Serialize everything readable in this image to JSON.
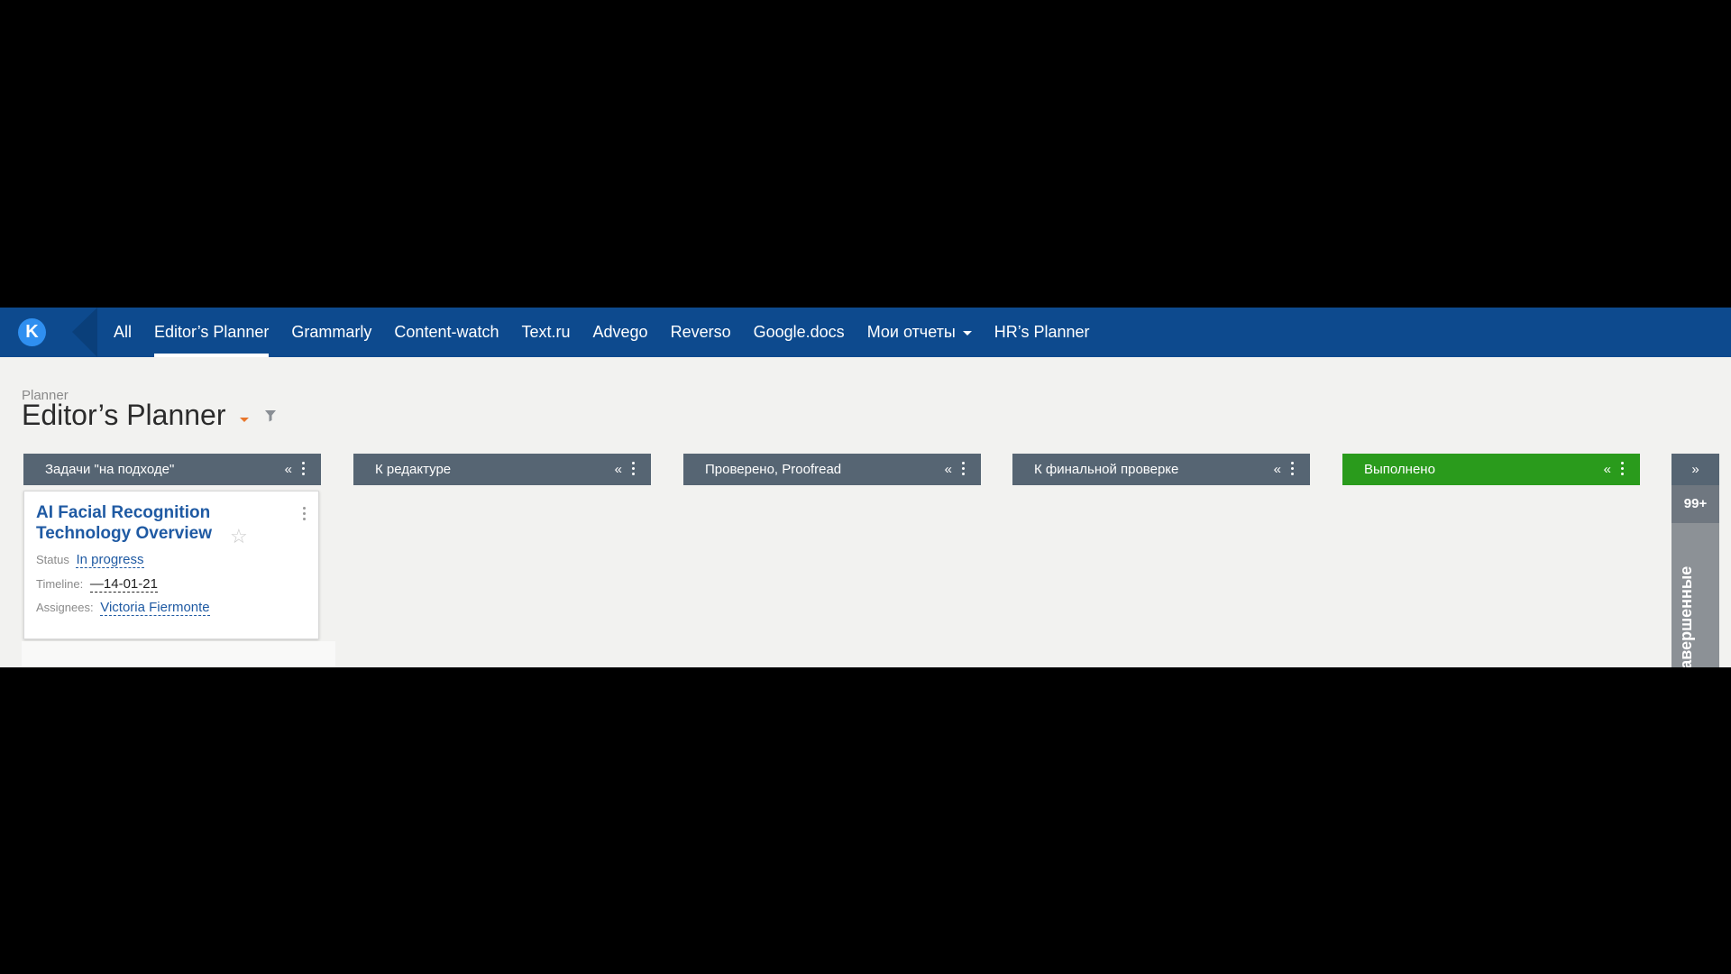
{
  "app": {
    "logo_letter": "K",
    "nav": [
      {
        "label": "All"
      },
      {
        "label": "Editor’s Planner",
        "active": true
      },
      {
        "label": "Grammarly"
      },
      {
        "label": "Content-watch"
      },
      {
        "label": "Text.ru"
      },
      {
        "label": "Advego"
      },
      {
        "label": "Reverso"
      },
      {
        "label": "Google.docs"
      },
      {
        "label": "Мои отчеты",
        "dropdown": true
      },
      {
        "label": "HR’s Planner"
      }
    ],
    "colors": {
      "nav_bg": "#0d4a8e",
      "column_header": "#566573",
      "done_header": "#2a9b1c",
      "link": "#1f5aa3",
      "accent": "#e8762b"
    }
  },
  "page": {
    "breadcrumb": "Planner",
    "title": "Editor’s Planner"
  },
  "columns": [
    {
      "title": "Задачи \"на подходе\"",
      "collapse": "«"
    },
    {
      "title": "К редактуре",
      "collapse": "«"
    },
    {
      "title": "Проверено, Proofread",
      "collapse": "«"
    },
    {
      "title": "К финальной проверке",
      "collapse": "«"
    },
    {
      "title": "Выполнено",
      "collapse": "«"
    }
  ],
  "card": {
    "title": "AI Facial Recognition Technology Overview",
    "status_label": "Status",
    "status_value": "In progress",
    "timeline_label": "Timeline:",
    "timeline_value": "—14-01-21",
    "assignees_label": "Assignees:",
    "assignees_value": "Victoria Fiermonte"
  },
  "side_panel": {
    "expand": "»",
    "count": "99+",
    "label": "Завершенные"
  }
}
